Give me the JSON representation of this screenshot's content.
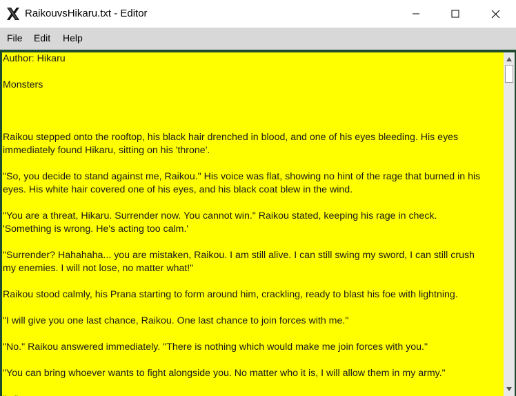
{
  "window": {
    "title": "RaikouvsHikaru.txt - Editor",
    "icon": "x-app-icon"
  },
  "controls": {
    "minimize": "minimize-icon",
    "maximize": "maximize-icon",
    "close": "close-icon"
  },
  "menu": {
    "file": "File",
    "edit": "Edit",
    "help": "Help"
  },
  "colors": {
    "editor_background": "#ffff00",
    "frame_border": "#1e4a2e",
    "menubar": "#d8d8d8"
  },
  "document": {
    "lines": [
      "Author: Hikaru",
      "",
      "Monsters",
      "",
      "",
      "",
      "Raikou stepped onto the rooftop, his black hair drenched in blood, and one of his eyes bleeding. His eyes",
      "immediately found Hikaru, sitting on his 'throne'.",
      "",
      "\"So, you decide to stand against me, Raikou.\" His voice was flat, showing no hint of the rage that burned in his",
      "eyes. His white hair covered one of his eyes, and his black coat blew in the wind.",
      "",
      "\"You are a threat, Hikaru. Surrender now. You cannot win.\" Raikou stated, keeping his rage in check.",
      "'Something is wrong. He's acting too calm.'",
      "",
      "\"Surrender? Hahahaha... you are mistaken, Raikou. I am still alive. I can still swing my sword, I can still crush",
      "my enemies. I will not lose, no matter what!\"",
      "",
      "Raikou stood calmly, his Prana starting to form around him, crackling, ready to blast his foe with lightning.",
      "",
      "\"I will give you one last chance, Raikou. One last chance to join forces with me.\"",
      "",
      "\"No.\" Raikou answered immediately. \"There is nothing which would make me join forces with you.\"",
      "",
      "\"You can bring whoever wants to fight alongside you. No matter who it is, I will allow them in my army.\"",
      "",
      "\"...\""
    ]
  }
}
